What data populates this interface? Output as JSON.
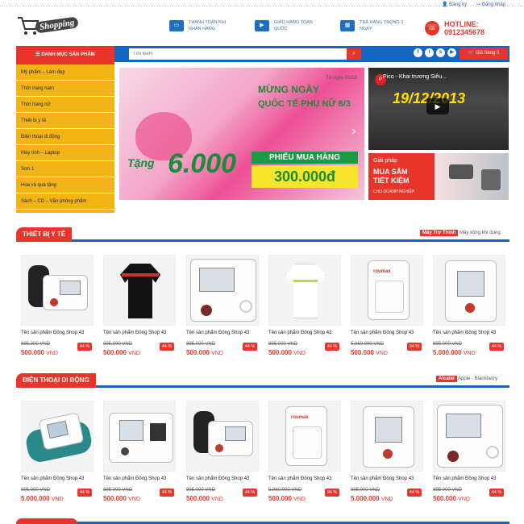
{
  "header": {
    "logo_text": "Shopping",
    "register": "Đăng ký",
    "login": "Đăng nhập",
    "features": [
      {
        "icon": "card-icon",
        "text": "Thanh toán khi nhận hàng"
      },
      {
        "icon": "truck-icon",
        "text": "Giao hàng toàn quốc"
      },
      {
        "icon": "calendar-icon",
        "text": "Trả hàng trong 3 ngày"
      }
    ],
    "hotline_label": "HOTLINE:",
    "hotline_number": "0912345678"
  },
  "nav": {
    "category_button": "Danh mục sản phẩm",
    "search_placeholder": "Tìm kiếm",
    "cart_label": "Giỏ hàng 0"
  },
  "sidebar": {
    "items": [
      {
        "label": "Mỹ phẩm – Làm đẹp"
      },
      {
        "label": "Thời trang nam"
      },
      {
        "label": "Thời trang nữ"
      },
      {
        "label": "Thiết bị y tế"
      },
      {
        "label": "Điện thoại di động"
      },
      {
        "label": "Máy tính – Laptop"
      },
      {
        "label": "Sơn 1"
      },
      {
        "label": "Hoa và quà tặng"
      },
      {
        "label": "Sách – CD – Văn phòng phẩm"
      }
    ]
  },
  "banner": {
    "date": "Từ ngày 01/03",
    "title1": "MỪNG NGÀY",
    "title2": "QUỐC TẾ PHỤ NỮ 8/3",
    "tang": "Tặng",
    "amount_big": "6.000",
    "voucher_label": "PHIẾU MUA HÀNG",
    "voucher_amount": "300.000đ"
  },
  "video": {
    "title": "Pico - Khai trương Siêu...",
    "date": "19/12/2013"
  },
  "promo": {
    "line1": "Giải pháp",
    "line2": "MUA SẮM",
    "line3": "TIẾT KIỆM",
    "line4": "CHO DOANH NGHIỆP"
  },
  "sections": [
    {
      "title": "THIẾT BỊ Y TẾ",
      "tabs": [
        "Máy Trợ Thính",
        "Máy xông khí dung"
      ],
      "products": [
        {
          "name": "Tên sản phẩm Đông Shop 43",
          "old_price": "895.000 VND",
          "price": "500.000",
          "currency": "VND",
          "discount": "44 %"
        },
        {
          "name": "Tên sản phẩm Đông Shop 43",
          "old_price": "895.000 VND",
          "price": "500.000",
          "currency": "VND",
          "discount": "44 %"
        },
        {
          "name": "Tên sản phẩm Đông Shop 43",
          "old_price": "895.000 VND",
          "price": "500.000",
          "currency": "VND",
          "discount": "44 %"
        },
        {
          "name": "Tên sản phẩm Đông Shop 43",
          "old_price": "895.000 VND",
          "price": "500.000",
          "currency": "VND",
          "discount": "44 %"
        },
        {
          "name": "Tên sản phẩm Đông Shop 43",
          "old_price": "5.960.000 VND",
          "price": "500.000",
          "currency": "VND",
          "discount": "94 %"
        },
        {
          "name": "Tên sản phẩm Đông Shop 43",
          "old_price": "895.000 VND",
          "price": "5.000.000",
          "currency": "VND",
          "discount": "44 %"
        }
      ]
    },
    {
      "title": "ĐIỆN THOẠI DI ĐỘNG",
      "tabs": [
        "Alcatel",
        "Apple",
        "Blackberry"
      ],
      "products": [
        {
          "name": "Tên sản phẩm Đông Shop 43",
          "old_price": "895.000 VND",
          "price": "5.000.000",
          "currency": "VND",
          "discount": "44 %"
        },
        {
          "name": "Tên sản phẩm Đông Shop 43",
          "old_price": "895.000 VND",
          "price": "500.000",
          "currency": "VND",
          "discount": "44 %"
        },
        {
          "name": "Tên sản phẩm Đông Shop 43",
          "old_price": "895.000 VND",
          "price": "500.000",
          "currency": "VND",
          "discount": "44 %"
        },
        {
          "name": "Tên sản phẩm Đông Shop 43",
          "old_price": "5.960.000 VND",
          "price": "500.000",
          "currency": "VND",
          "discount": "94 %"
        },
        {
          "name": "Tên sản phẩm Đông Shop 43",
          "old_price": "895.000 VND",
          "price": "5.000.000",
          "currency": "VND",
          "discount": "44 %"
        },
        {
          "name": "Tên sản phẩm Đông Shop 43",
          "old_price": "895.000 VND",
          "price": "500.000",
          "currency": "VND",
          "discount": "44 %"
        }
      ]
    }
  ],
  "colors": {
    "accent": "#e8352c",
    "nav": "#1565c0",
    "sidebar": "#f3b516"
  }
}
